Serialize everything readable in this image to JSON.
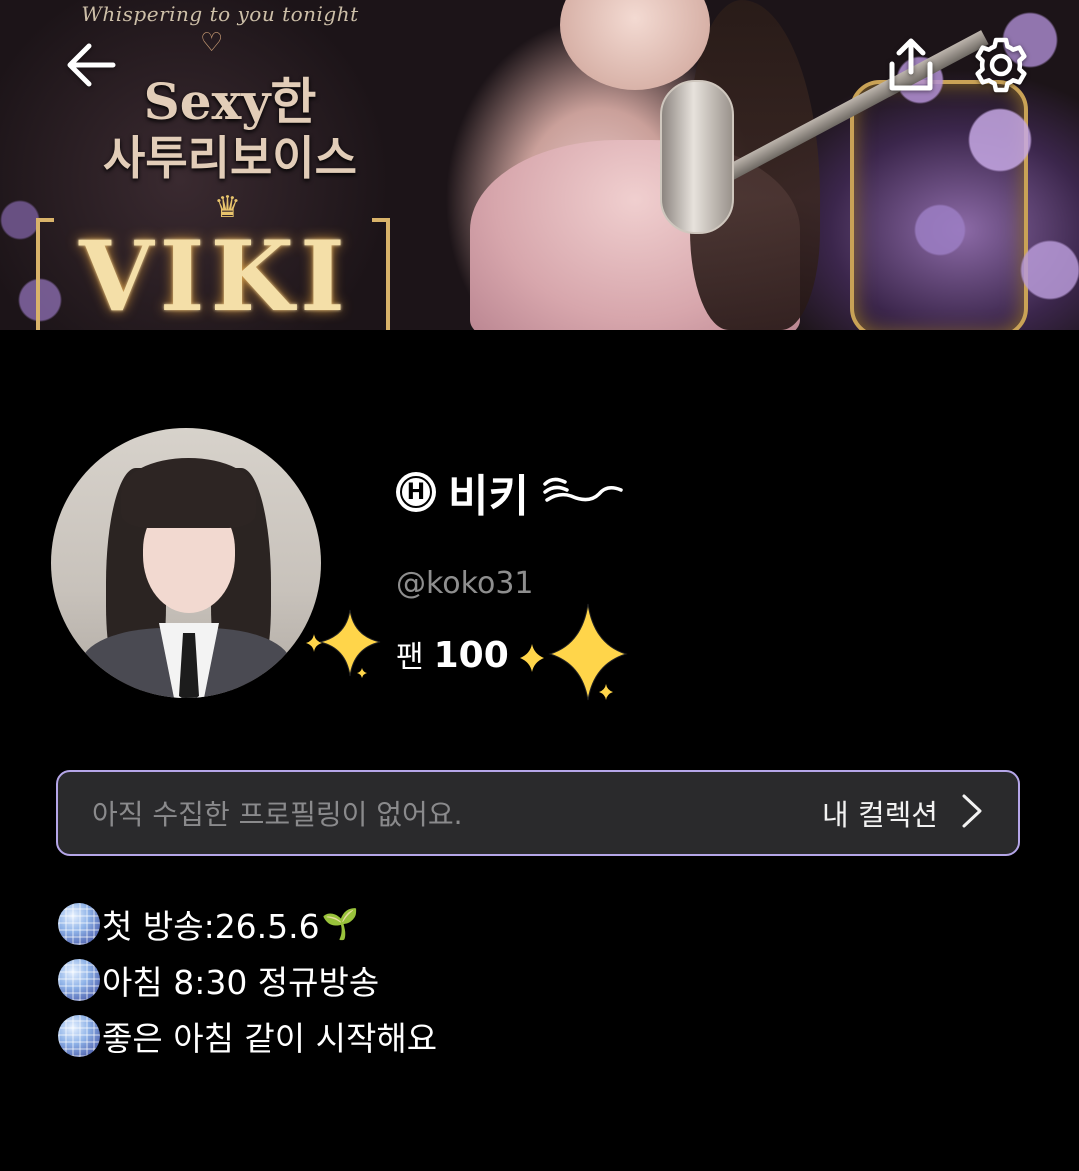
{
  "banner": {
    "whisper": "Whispering to you tonight",
    "title_line1": "Sexy한",
    "title_line2": "사투리보이스",
    "title_main": "VIKI"
  },
  "header": {
    "back_icon": "arrow-left-icon",
    "share_icon": "share-upload-icon",
    "settings_icon": "gear-icon"
  },
  "profile": {
    "badge_letter": "H",
    "display_name": "비키",
    "name_suffix": "〜",
    "handle": "@koko31",
    "fans_label": "팬",
    "fans_count": "100"
  },
  "collection": {
    "empty_text": "아직 수집한 프로필링이 없어요.",
    "link_label": "내 컬렉션"
  },
  "bio": {
    "lines": [
      {
        "text": "첫 방송:26.5.6",
        "trail": "🌱"
      },
      {
        "text": "아침 8:30 정규방송",
        "trail": ""
      },
      {
        "text": "좋은 아침 같이 시작해요",
        "trail": ""
      }
    ]
  },
  "colors": {
    "background": "#000000",
    "collection_border": "#b5a6e8",
    "collection_bg": "#2a2a2c",
    "sparkle": "#ffd54a",
    "handle_gray": "#8e8e8e"
  }
}
